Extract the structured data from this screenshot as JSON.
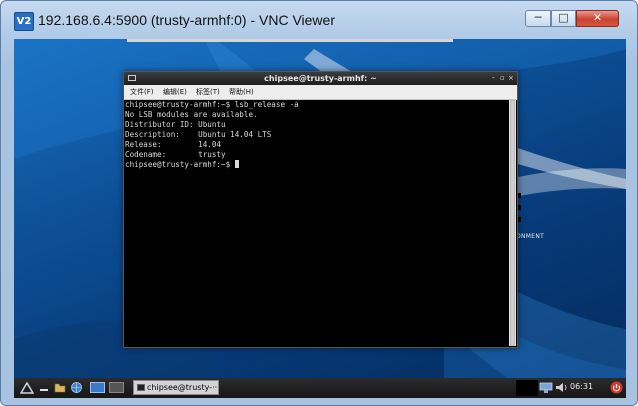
{
  "vnc_window": {
    "title": "192.168.6.4:5900 (trusty-armhf:0) - VNC Viewer",
    "app_icon_text": "V2",
    "buttons": {
      "minimize": "─",
      "maximize": "□",
      "close": "✕"
    }
  },
  "desktop": {
    "side_text": "ONMENT"
  },
  "terminal": {
    "title": "chipsee@trusty-armhf: ~",
    "controls": {
      "minimize": "-",
      "maximize": "▫",
      "close": "×"
    },
    "menu": [
      "文件(F)",
      "编辑(E)",
      "标签(T)",
      "帮助(H)"
    ],
    "lines": [
      "chipsee@trusty-armhf:~$ lsb_release -a",
      "No LSB modules are available.",
      "Distributor ID: Ubuntu",
      "Description:    Ubuntu 14.04 LTS",
      "Release:        14.04",
      "Codename:       trusty"
    ],
    "prompt": "chipsee@trusty-armhf:~$ "
  },
  "panel": {
    "taskbar_item": "chipsee@trusty-···",
    "clock": "06:31",
    "icons": [
      "start-menu-icon",
      "minimize-all-icon",
      "file-manager-icon",
      "browser-icon",
      "workspace-1-icon",
      "workspace-2-icon",
      "network-icon",
      "volume-icon",
      "power-icon"
    ]
  },
  "colors": {
    "desktop_blue": "#0d4f96",
    "terminal_bg": "#000000",
    "terminal_fg": "#d9d9d9",
    "panel_bg": "#1e1e1e",
    "close_red": "#c8442f"
  }
}
